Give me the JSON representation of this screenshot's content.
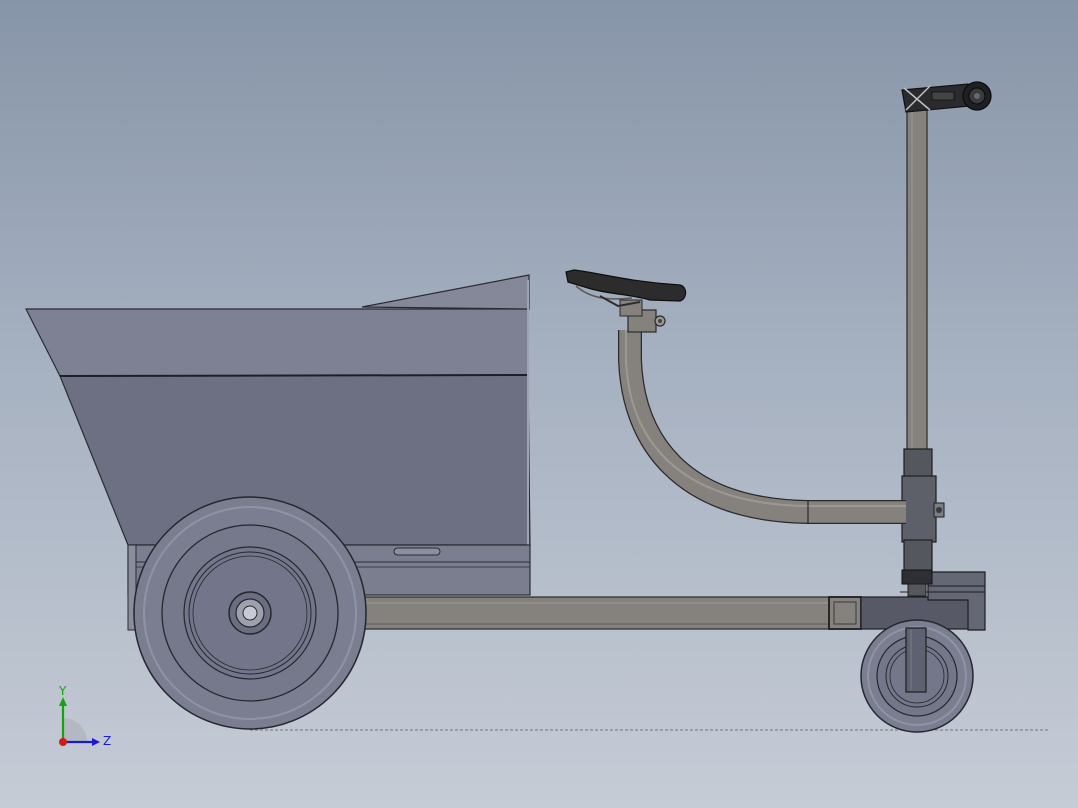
{
  "triad": {
    "y_label": "Y",
    "z_label": "Z",
    "y_color": "#11a611",
    "z_color": "#1a1ad4",
    "x_color": "#d41a1a"
  },
  "model_colors": {
    "background_top": "#8795a8",
    "background_bottom": "#c6ccd6",
    "body_panel": "#6f7284",
    "tube": "#85827e",
    "frame_dark": "#575a66",
    "tire": "#787c8e",
    "seat": "#2c2c2c"
  }
}
